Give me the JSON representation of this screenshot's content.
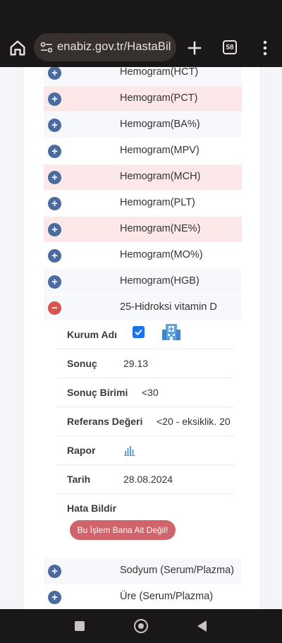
{
  "browser": {
    "url": "enabiz.gov.tr/HastaBil",
    "tab_count": "58"
  },
  "tests": [
    {
      "label": "Hemogram(HCT)",
      "state": "collapsed"
    },
    {
      "label": "Hemogram(PCT)",
      "state": "collapsed"
    },
    {
      "label": "Hemogram(BA%)",
      "state": "collapsed"
    },
    {
      "label": "Hemogram(MPV)",
      "state": "collapsed"
    },
    {
      "label": "Hemogram(MCH)",
      "state": "collapsed"
    },
    {
      "label": "Hemogram(PLT)",
      "state": "collapsed"
    },
    {
      "label": "Hemogram(NE%)",
      "state": "collapsed"
    },
    {
      "label": "Hemogram(MO%)",
      "state": "collapsed"
    },
    {
      "label": "Hemogram(HGB)",
      "state": "collapsed"
    },
    {
      "label": "25-Hidroksi vitamin D",
      "state": "expanded"
    },
    {
      "label": "Sodyum (Serum/Plazma)",
      "state": "collapsed"
    },
    {
      "label": "Üre (Serum/Plazma)",
      "state": "collapsed"
    }
  ],
  "detail": {
    "kurum_adi_label": "Kurum Adı",
    "sonuc_label": "Sonuç",
    "sonuc_value": "29.13",
    "sonuc_birimi_label": "Sonuç Birimi",
    "sonuc_birimi_value": "<30",
    "referans_label": "Referans Değeri",
    "referans_value": "<20 - eksiklik. 20",
    "rapor_label": "Rapor",
    "tarih_label": "Tarih",
    "tarih_value": "28.08.2024",
    "hata_label": "Hata Bildir",
    "report_button": "Bu İşlem Bana Ait Değil!"
  },
  "icons": {
    "collapsed": "plus",
    "expanded": "minus"
  },
  "colors": {
    "plus_button": "#4a6aa0",
    "minus_button": "#d9534f",
    "report_button": "#d1636b",
    "highlight_row": "#fde8e9"
  }
}
